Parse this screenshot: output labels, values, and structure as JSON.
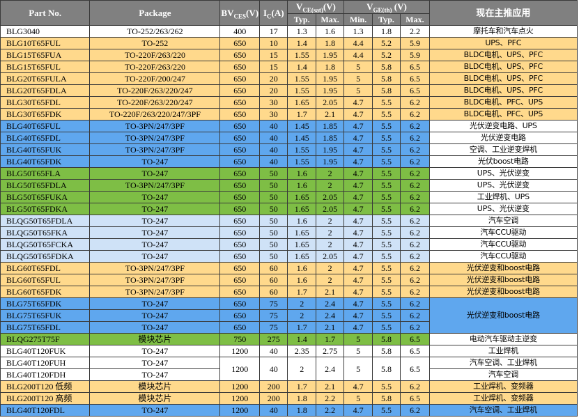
{
  "headers": {
    "part_no": "Part No.",
    "package": "Package",
    "bvces": "BV",
    "bvces_sub": "CES",
    "bvces_unit": "(V)",
    "ic": "I",
    "ic_sub": "C",
    "ic_unit": "(A)",
    "vce": "V",
    "vce_sub": "CE(sat)",
    "vce_unit": "(V)",
    "vge": "V",
    "vge_sub": "GE(th)",
    "vge_unit": " (V)",
    "application": "现在主推应用",
    "typ": "Typ.",
    "max": "Max.",
    "min": "Min.",
    "typ2": "Typ.",
    "max2": "Max."
  },
  "colors": {
    "header": "#808080",
    "yellow": "#ffd98c",
    "blue": "#5fa7ee",
    "green": "#7ebe45",
    "light_blue": "#cfe2f7",
    "white": "#ffffff"
  },
  "rows": [
    {
      "part": "BLG3040",
      "pkg": "TO-252/263/262",
      "bv": "400",
      "ic": "17",
      "vce_typ": "1.3",
      "vce_max": "1.6",
      "vge_min": "1.3",
      "vge_typ": "1.8",
      "vge_max": "2.2",
      "app": "摩托车和汽车点火"
    },
    {
      "part": "BLG10T65FUL",
      "pkg": "TO-252",
      "bv": "650",
      "ic": "10",
      "vce_typ": "1.4",
      "vce_max": "1.8",
      "vge_min": "4.4",
      "vge_typ": "5.2",
      "vge_max": "5.9",
      "app": "UPS、PFC"
    },
    {
      "part": "BLG15T65FUA",
      "pkg": "TO-220F/263/220",
      "bv": "650",
      "ic": "15",
      "vce_typ": "1.55",
      "vce_max": "1.95",
      "vge_min": "4.4",
      "vge_typ": "5.2",
      "vge_max": "5.9",
      "app": "BLDC电机、UPS、PFC"
    },
    {
      "part": "BLG15T65FUL",
      "pkg": "TO-220F/263/220",
      "bv": "650",
      "ic": "15",
      "vce_typ": "1.4",
      "vce_max": "1.8",
      "vge_min": "5",
      "vge_typ": "5.8",
      "vge_max": "6.5",
      "app": "BLDC电机、UPS、PFC"
    },
    {
      "part": "BLG20T65FULA",
      "pkg": "TO-220F/200/247",
      "bv": "650",
      "ic": "20",
      "vce_typ": "1.55",
      "vce_max": "1.95",
      "vge_min": "5",
      "vge_typ": "5.8",
      "vge_max": "6.5",
      "app": "BLDC电机、UPS、PFC"
    },
    {
      "part": "BLG20T65FDLA",
      "pkg": "TO-220F/263/220/247",
      "bv": "650",
      "ic": "20",
      "vce_typ": "1.55",
      "vce_max": "1.95",
      "vge_min": "5",
      "vge_typ": "5.8",
      "vge_max": "6.5",
      "app": "BLDC电机、UPS、PFC"
    },
    {
      "part": "BLG30T65FDL",
      "pkg": "TO-220F/263/220/247",
      "bv": "650",
      "ic": "30",
      "vce_typ": "1.65",
      "vce_max": "2.05",
      "vge_min": "4.7",
      "vge_typ": "5.5",
      "vge_max": "6.2",
      "app": "BLDC电机、PFC、UPS"
    },
    {
      "part": "BLG30T65FDK",
      "pkg": "TO-220F/263/220/247/3PF",
      "bv": "650",
      "ic": "30",
      "vce_typ": "1.7",
      "vce_max": "2.1",
      "vge_min": "4.7",
      "vge_typ": "5.5",
      "vge_max": "6.2",
      "app": "BLDC电机、PFC、UPS"
    },
    {
      "part": "BLG40T65FUL",
      "pkg": "TO-3PN/247/3PF",
      "bv": "650",
      "ic": "40",
      "vce_typ": "1.45",
      "vce_max": "1.85",
      "vge_min": "4.7",
      "vge_typ": "5.5",
      "vge_max": "6.2",
      "app": "光伏逆变电路、UPS"
    },
    {
      "part": "BLG40T65FDL",
      "pkg": "TO-3PN/247/3PF",
      "bv": "650",
      "ic": "40",
      "vce_typ": "1.45",
      "vce_max": "1.85",
      "vge_min": "4.7",
      "vge_typ": "5.5",
      "vge_max": "6.2",
      "app": "光伏逆变电路"
    },
    {
      "part": "BLG40T65FUK",
      "pkg": "TO-3PN/247/3PF",
      "bv": "650",
      "ic": "40",
      "vce_typ": "1.55",
      "vce_max": "1.95",
      "vge_min": "4.7",
      "vge_typ": "5.5",
      "vge_max": "6.2",
      "app": "空调、工业逆变焊机"
    },
    {
      "part": "BLG40T65FDK",
      "pkg": "TO-247",
      "bv": "650",
      "ic": "40",
      "vce_typ": "1.55",
      "vce_max": "1.95",
      "vge_min": "4.7",
      "vge_typ": "5.5",
      "vge_max": "6.2",
      "app": "光伏boost电路"
    },
    {
      "part": "BLG50T65FLA",
      "pkg": "TO-247",
      "bv": "650",
      "ic": "50",
      "vce_typ": "1.6",
      "vce_max": "2",
      "vge_min": "4.7",
      "vge_typ": "5.5",
      "vge_max": "6.2",
      "app": "UPS、光伏逆变"
    },
    {
      "part": "BLG50T65FDLA",
      "pkg": "TO-3PN/247/3PF",
      "bv": "650",
      "ic": "50",
      "vce_typ": "1.6",
      "vce_max": "2",
      "vge_min": "4.7",
      "vge_typ": "5.5",
      "vge_max": "6.2",
      "app": "UPS、光伏逆变"
    },
    {
      "part": "BLG50T65FUKA",
      "pkg": "TO-247",
      "bv": "650",
      "ic": "50",
      "vce_typ": "1.65",
      "vce_max": "2.05",
      "vge_min": "4.7",
      "vge_typ": "5.5",
      "vge_max": "6.2",
      "app": "工业焊机、UPS"
    },
    {
      "part": "BLG50T65FDKA",
      "pkg": "TO-247",
      "bv": "650",
      "ic": "50",
      "vce_typ": "1.65",
      "vce_max": "2.05",
      "vge_min": "4.7",
      "vge_typ": "5.5",
      "vge_max": "6.2",
      "app": "UPS、光伏逆变"
    },
    {
      "part": "BLQG50T65FDLA",
      "pkg": "TO-247",
      "bv": "650",
      "ic": "50",
      "vce_typ": "1.6",
      "vce_max": "2",
      "vge_min": "4.7",
      "vge_typ": "5.5",
      "vge_max": "6.2",
      "app": "汽车空调"
    },
    {
      "part": "BLQG50T65FKA",
      "pkg": "TO-247",
      "bv": "650",
      "ic": "50",
      "vce_typ": "1.65",
      "vce_max": "2",
      "vge_min": "4.7",
      "vge_typ": "5.5",
      "vge_max": "6.2",
      "app": "汽车CCU驱动"
    },
    {
      "part": "BLQG50T65FCKA",
      "pkg": "TO-247",
      "bv": "650",
      "ic": "50",
      "vce_typ": "1.65",
      "vce_max": "2",
      "vge_min": "4.7",
      "vge_typ": "5.5",
      "vge_max": "6.2",
      "app": "汽车CCU驱动"
    },
    {
      "part": "BLQG50T65FDKA",
      "pkg": "TO-247",
      "bv": "650",
      "ic": "50",
      "vce_typ": "1.65",
      "vce_max": "2.05",
      "vge_min": "4.7",
      "vge_typ": "5.5",
      "vge_max": "6.2",
      "app": "汽车CCU驱动"
    },
    {
      "part": "BLG60T65FDL",
      "pkg": "TO-3PN/247/3PF",
      "bv": "650",
      "ic": "60",
      "vce_typ": "1.6",
      "vce_max": "2",
      "vge_min": "4.7",
      "vge_typ": "5.5",
      "vge_max": "6.2",
      "app": "光伏逆变和boost电路"
    },
    {
      "part": "BLG60T65FUL",
      "pkg": "TO-3PN/247/3PF",
      "bv": "650",
      "ic": "60",
      "vce_typ": "1.6",
      "vce_max": "2",
      "vge_min": "4.7",
      "vge_typ": "5.5",
      "vge_max": "6.2",
      "app": "光伏逆变和boost电路"
    },
    {
      "part": "BLG60T65FDK",
      "pkg": "TO-3PN/247/3PF",
      "bv": "650",
      "ic": "60",
      "vce_typ": "1.7",
      "vce_max": "2.1",
      "vge_min": "4.7",
      "vge_typ": "5.5",
      "vge_max": "6.2",
      "app": "光伏逆变和boost电路"
    },
    {
      "part": "BLG75T65FDK",
      "pkg": "TO-247",
      "bv": "650",
      "ic": "75",
      "vce_typ": "2",
      "vce_max": "2.4",
      "vge_min": "4.7",
      "vge_typ": "5.5",
      "vge_max": "6.2",
      "app": "光伏逆变和boost电路"
    },
    {
      "part": "BLG75T65FUK",
      "pkg": "TO-247",
      "bv": "650",
      "ic": "75",
      "vce_typ": "2",
      "vce_max": "2.4",
      "vge_min": "4.7",
      "vge_typ": "5.5",
      "vge_max": "6.2"
    },
    {
      "part": "BLG75T65FDL",
      "pkg": "TO-247",
      "bv": "650",
      "ic": "75",
      "vce_typ": "1.7",
      "vce_max": "2.1",
      "vge_min": "4.7",
      "vge_typ": "5.5",
      "vge_max": "6.2"
    },
    {
      "part": "BLQG275T75F",
      "pkg": "模块芯片",
      "bv": "750",
      "ic": "275",
      "vce_typ": "1.4",
      "vce_max": "1.7",
      "vge_min": "5",
      "vge_typ": "5.8",
      "vge_max": "6.5",
      "app": "电动汽车驱动主逆变"
    },
    {
      "part": "BLG40T120FUK",
      "pkg": "TO-247",
      "bv": "1200",
      "ic": "40",
      "vce_typ": "2.35",
      "vce_max": "2.75",
      "vge_min": "5",
      "vge_typ": "5.8",
      "vge_max": "6.5",
      "app": "工业焊机"
    },
    {
      "part": "BLG40T120FUH",
      "pkg": "TO-247",
      "bv": "1200",
      "ic": "40",
      "vce_typ": "2",
      "vce_max": "2.4",
      "vge_min": "5",
      "vge_typ": "5.8",
      "vge_max": "6.5",
      "app": "汽车空调、工业焊机"
    },
    {
      "part": "BLG40T120FDH",
      "pkg": "TO-247",
      "app": "汽车空调"
    },
    {
      "part": "BLG200T120 低频",
      "pkg": "模块芯片",
      "bv": "1200",
      "ic": "200",
      "vce_typ": "1.7",
      "vce_max": "2.1",
      "vge_min": "4.7",
      "vge_typ": "5.5",
      "vge_max": "6.2",
      "app": "工业焊机、变频器"
    },
    {
      "part": "BLG200T120 高频",
      "pkg": "模块芯片",
      "bv": "1200",
      "ic": "200",
      "vce_typ": "1.8",
      "vce_max": "2.2",
      "vge_min": "5",
      "vge_typ": "5.8",
      "vge_max": "6.5",
      "app": "工业焊机、变频器"
    },
    {
      "part": "BLG40T120FDL",
      "pkg": "TO-247",
      "bv": "1200",
      "ic": "40",
      "vce_typ": "1.8",
      "vce_max": "2.2",
      "vge_min": "4.7",
      "vge_typ": "5.5",
      "vge_max": "6.2",
      "app": "汽车空调、工业焊机"
    }
  ]
}
